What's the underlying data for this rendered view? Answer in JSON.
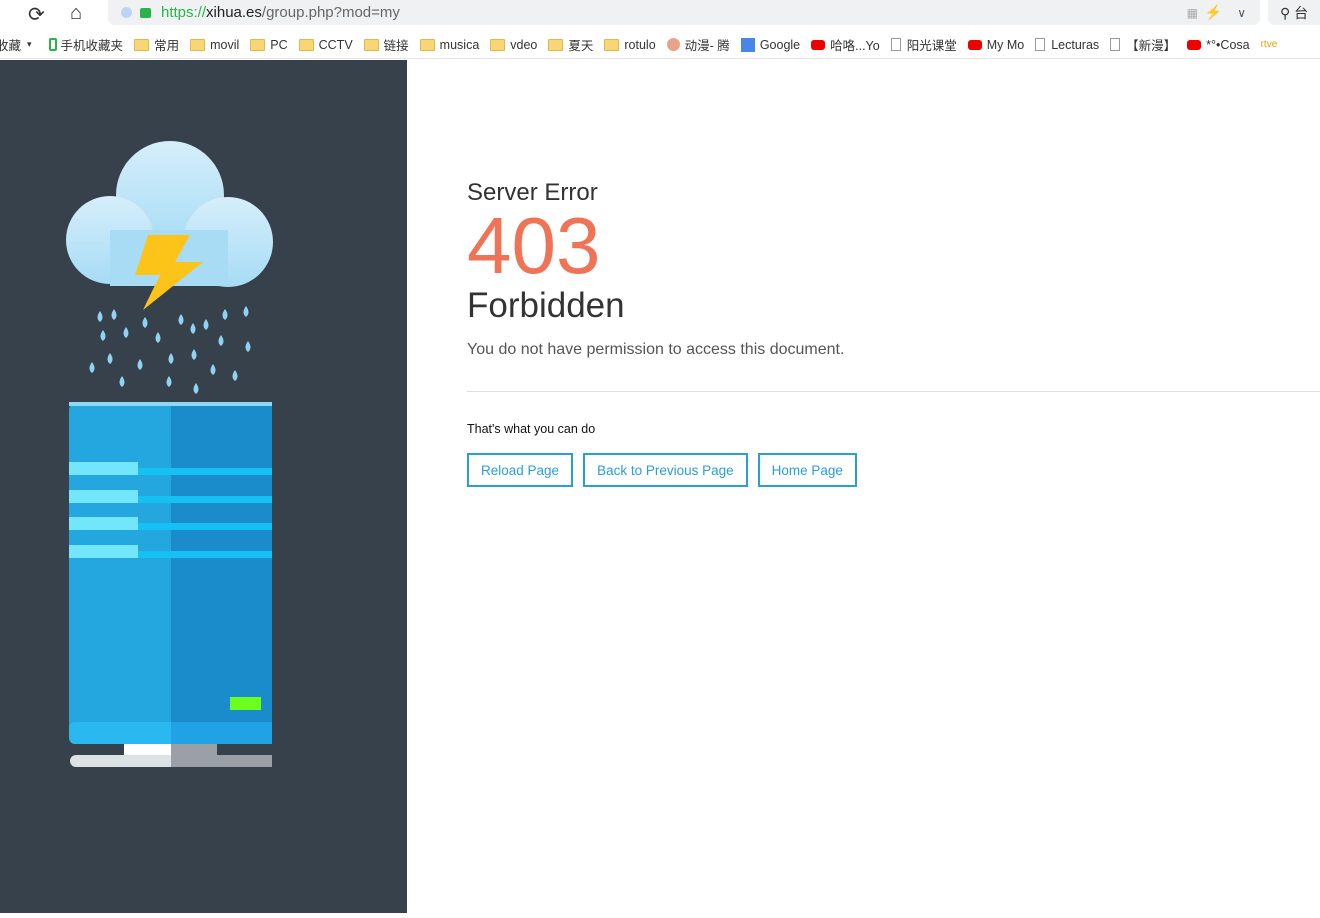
{
  "browser": {
    "url": {
      "scheme": "https://",
      "host": "xihua.es",
      "path": "/group.php?mod=my"
    },
    "search_partial": "台",
    "bookmarks": [
      {
        "label": "收藏",
        "icon": "dropdown"
      },
      {
        "label": "手机收藏夹",
        "icon": "phone-icon"
      },
      {
        "label": "常用",
        "icon": "folder-icon"
      },
      {
        "label": "movil",
        "icon": "folder-icon"
      },
      {
        "label": "PC",
        "icon": "folder-icon"
      },
      {
        "label": "CCTV",
        "icon": "folder-icon"
      },
      {
        "label": "链接",
        "icon": "folder-icon"
      },
      {
        "label": "musica",
        "icon": "folder-icon"
      },
      {
        "label": "vdeo",
        "icon": "folder-icon"
      },
      {
        "label": "夏天",
        "icon": "folder-icon"
      },
      {
        "label": "rotulo",
        "icon": "folder-icon"
      },
      {
        "label": "动漫- 腾",
        "icon": "avatar-icon"
      },
      {
        "label": "Google",
        "icon": "google-translate-icon"
      },
      {
        "label": "哈咯...Yo",
        "icon": "youtube-icon"
      },
      {
        "label": "阳光课堂",
        "icon": "page-icon"
      },
      {
        "label": "My Mo",
        "icon": "youtube-icon"
      },
      {
        "label": "Lecturas",
        "icon": "page-icon"
      },
      {
        "label": "【新漫】",
        "icon": "page-icon"
      },
      {
        "label": "*°•Cosa",
        "icon": "youtube-icon"
      },
      {
        "label": "rtve",
        "icon": "rtve-icon"
      }
    ]
  },
  "error": {
    "heading": "Server Error",
    "code": "403",
    "title": "Forbidden",
    "message": "You do not have permission to access this document.",
    "actions_label": "That's what you can do",
    "buttons": [
      "Reload Page",
      "Back to Previous Page",
      "Home Page"
    ]
  },
  "colors": {
    "sidebar": "#37414b",
    "code": "#ef7356",
    "accent": "#2a9fd6"
  }
}
